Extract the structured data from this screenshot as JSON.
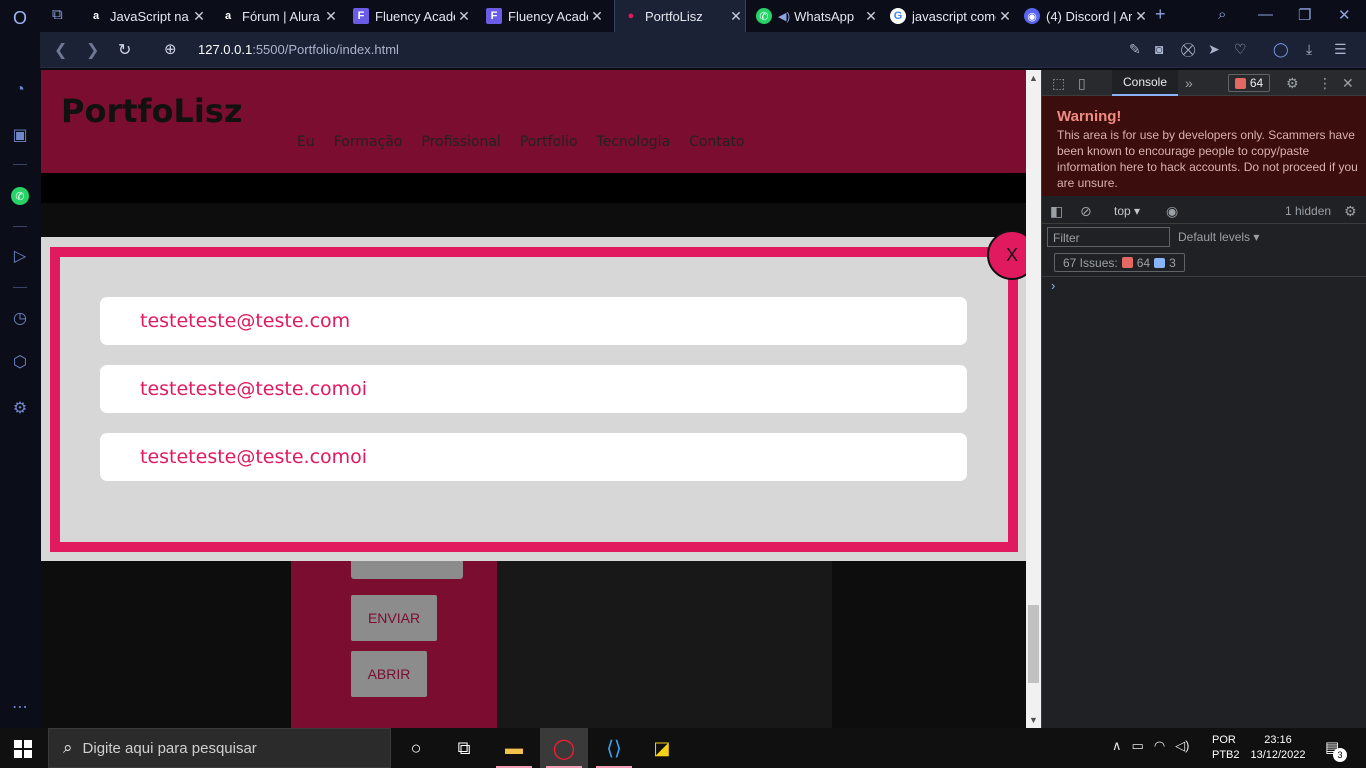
{
  "browser": {
    "tabs": [
      {
        "title": "JavaScript na W",
        "favicon": "a"
      },
      {
        "title": "Fórum | Alura -",
        "favicon": "a"
      },
      {
        "title": "Fluency Acader",
        "favicon": "F"
      },
      {
        "title": "Fluency Acader",
        "favicon": "F"
      },
      {
        "title": "PortfoLisz",
        "favicon": "●"
      },
      {
        "title": "WhatsApp",
        "favicon": "✆"
      },
      {
        "title": "javascript como",
        "favicon": "G"
      },
      {
        "title": "(4) Discord | Ar",
        "favicon": "◉"
      }
    ],
    "tab_close": "✕",
    "new_tab": "+",
    "url_host": "127.0.0.1",
    "url_path": ":5500/Portfolio/index.html"
  },
  "site": {
    "logo": "PortfoLisz",
    "nav": [
      "Eu",
      "Formação",
      "Profissional",
      "Portfolio",
      "Tecnologia",
      "Contato"
    ],
    "buttons": {
      "send": "ENVIAR",
      "open": "ABRIR"
    },
    "colors": {
      "header": "#7a0d30",
      "accent": "#e1195f"
    }
  },
  "modal": {
    "close_label": "X",
    "emails": [
      "testeteste@teste.com",
      "testeteste@teste.comoi",
      "testeteste@teste.comoi"
    ]
  },
  "devtools": {
    "tab_console": "Console",
    "error_count": "64",
    "warning_title": "Warning!",
    "warning_text": "This area is for use by developers only. Scammers have been known to encourage people to copy/paste information here to hack accounts. Do not proceed if you are unsure.",
    "context": "top",
    "hidden": "1 hidden",
    "filter_placeholder": "Filter",
    "levels": "Default levels",
    "issues_label": "67 Issues:",
    "issues_errors": "64",
    "issues_info": "3",
    "prompt": "›"
  },
  "taskbar": {
    "search_placeholder": "Digite aqui para pesquisar",
    "lang_top": "POR",
    "lang_bottom": "PTB2",
    "time": "23:16",
    "date": "13/12/2022",
    "notif_count": "3"
  }
}
